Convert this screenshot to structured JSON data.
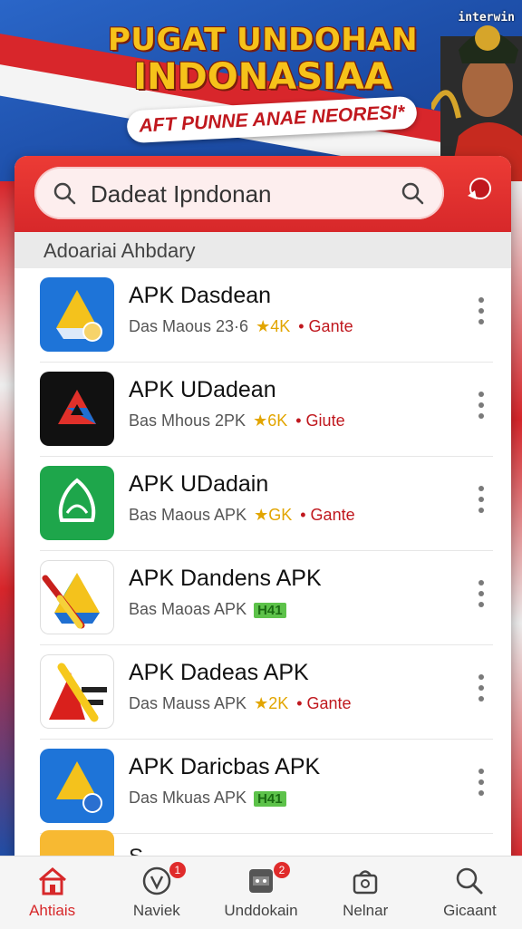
{
  "banner": {
    "title_line1": "PUGAT UNDOHAN",
    "title_line2": "INDONASIAA",
    "ribbon": "AFT PUNNE ANAE NEORESI*",
    "watermark": "interwin"
  },
  "search": {
    "query": "Dadeat Ipndonan",
    "search_icon": "search-icon",
    "notification_icon": "megaphone-icon"
  },
  "section": {
    "title": "Adoariai Ahbdary"
  },
  "apps": [
    {
      "name": "APK Dasdean",
      "meta": "Das  Maous 23·6",
      "rating": "★4K",
      "tag": "• Gante",
      "badge": ""
    },
    {
      "name": "APK UDadean",
      "meta": "Bas  Mhous 2PK",
      "rating": "★6K",
      "tag": "• Giute",
      "badge": ""
    },
    {
      "name": "APK UDadain",
      "meta": "Bas  Maous APK",
      "rating": "★GK",
      "tag": "• Gante",
      "badge": ""
    },
    {
      "name": "APK Dandens APK",
      "meta": "Bas  Maoas APK",
      "rating": "",
      "tag": "",
      "badge": "H41"
    },
    {
      "name": "APK Dadeas APK",
      "meta": "Das  Mauss APK",
      "rating": "★2K",
      "tag": "• Gante",
      "badge": ""
    },
    {
      "name": "APK Daricbas APK",
      "meta": "Das  Mkuas APK",
      "rating": "",
      "tag": "",
      "badge": "H41"
    }
  ],
  "peek_row": {
    "name": "S..."
  },
  "bottom_nav": [
    {
      "label": "Ahtiais",
      "icon": "home-icon",
      "badge": "",
      "active": true
    },
    {
      "label": "Naviek",
      "icon": "verified-icon",
      "badge": "1",
      "active": false
    },
    {
      "label": "Unddokain",
      "icon": "downloads-icon",
      "badge": "2",
      "active": false
    },
    {
      "label": "Nelnar",
      "icon": "bag-icon",
      "badge": "",
      "active": false
    },
    {
      "label": "Gicaant",
      "icon": "search-icon",
      "badge": "",
      "active": false
    }
  ],
  "colors": {
    "accent_red": "#d7282a",
    "banner_blue": "#1d4ea8",
    "title_gold": "#f6c21a",
    "rating_gold": "#e2a500"
  }
}
